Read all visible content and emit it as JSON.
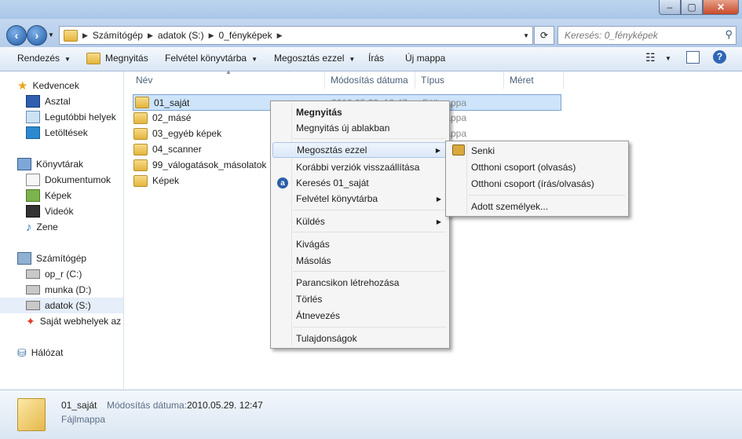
{
  "window": {
    "min": "–",
    "max": "▢",
    "close": "✕"
  },
  "address": {
    "crumbs": [
      "Számítógép",
      "adatok (S:)",
      "0_fényképek"
    ]
  },
  "search": {
    "placeholder": "Keresés: 0_fényképek"
  },
  "toolbar": {
    "organize": "Rendezés",
    "open": "Megnyitás",
    "burn": "Felvétel könyvtárba",
    "share": "Megosztás ezzel",
    "write": "Írás",
    "newfolder": "Új mappa"
  },
  "sidebar": {
    "favorites": "Kedvencek",
    "desktop": "Asztal",
    "recent": "Legutóbbi helyek",
    "downloads": "Letöltések",
    "libraries": "Könyvtárak",
    "documents": "Dokumentumok",
    "pictures": "Képek",
    "videos": "Videók",
    "music": "Zene",
    "computer": "Számítógép",
    "drive_c": "op_r (C:)",
    "drive_d": "munka (D:)",
    "drive_s": "adatok (S:)",
    "websites": "Saját webhelyek az M",
    "network": "Hálózat"
  },
  "columns": {
    "name": "Név",
    "date": "Módosítás dátuma",
    "type": "Típus",
    "size": "Méret"
  },
  "files": [
    {
      "name": "01_saját",
      "date": "2010.05.29. 12:47",
      "type": "Fájlmappa"
    },
    {
      "name": "02_másé",
      "date": "",
      "type": "Fájlmappa"
    },
    {
      "name": "03_egyéb képek",
      "date": "",
      "type": "Fájlmappa"
    },
    {
      "name": "04_scanner",
      "date": "",
      "type": ""
    },
    {
      "name": "99_válogatások_másolatok",
      "date": "",
      "type": ""
    },
    {
      "name": "Képek",
      "date": "",
      "type": ""
    }
  ],
  "context_menu": {
    "open": "Megnyitás",
    "open_new": "Megnyitás új ablakban",
    "share": "Megosztás ezzel",
    "restore": "Korábbi verziók visszaállítása",
    "search": "Keresés 01_saját",
    "burn": "Felvétel könyvtárba",
    "send": "Küldés",
    "cut": "Kivágás",
    "copy": "Másolás",
    "shortcut": "Parancsikon létrehozása",
    "delete": "Törlés",
    "rename": "Átnevezés",
    "properties": "Tulajdonságok"
  },
  "submenu": {
    "nobody": "Senki",
    "home_read": "Otthoni csoport (olvasás)",
    "home_rw": "Otthoni csoport (írás/olvasás)",
    "specific": "Adott személyek..."
  },
  "details": {
    "name": "01_saját",
    "date_label": "Módosítás dátuma:",
    "date": "2010.05.29. 12:47",
    "type": "Fájlmappa"
  }
}
